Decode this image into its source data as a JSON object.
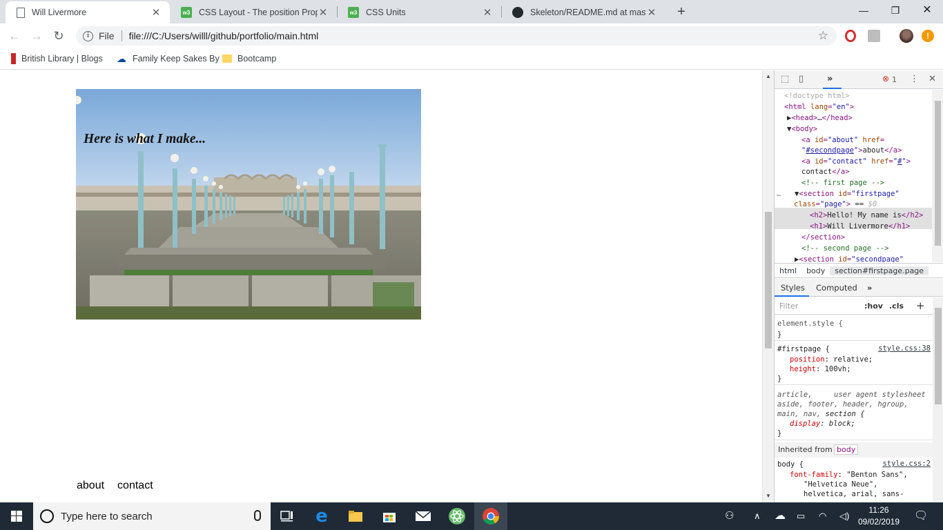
{
  "browser": {
    "tabs": [
      {
        "title": "Will Livermore",
        "icon": "document-icon",
        "active": true
      },
      {
        "title": "CSS Layout - The position Prope",
        "icon": "w3schools-icon",
        "active": false
      },
      {
        "title": "CSS Units",
        "icon": "w3schools-icon",
        "active": false
      },
      {
        "title": "Skeleton/README.md at master",
        "icon": "github-icon",
        "active": false
      }
    ],
    "new_tab": "+",
    "address": {
      "scheme": "File",
      "url": "file:///C:/Users/willl/github/portfolio/main.html"
    },
    "bookmarks": [
      {
        "label": "British Library | Blogs",
        "icon": "british-library-icon"
      },
      {
        "label": "Family Keep Sakes By",
        "icon": "onedrive-icon"
      },
      {
        "label": "Bootcamp",
        "icon": "folder-icon"
      }
    ]
  },
  "page": {
    "heading": "Here is what I make...",
    "nav": {
      "about": "about",
      "contact": "contact"
    }
  },
  "devtools": {
    "error_count": "1",
    "dom": [
      "<!doctype html>",
      "<html lang=\"en\">",
      "<head>…</head>",
      "<body>",
      "<a id=\"about\" href=",
      "\"#secondpage\">about</a>",
      "<a id=\"contact\" href=\"#\">",
      "contact</a>",
      "<!-- first page -->",
      "<section id=\"firstpage\"",
      "class=\"page\"> == $0",
      "<h2>Hello! My name is</h2>",
      "<h1>Will Livermore</h1>",
      "</section>",
      "<!-- second page -->",
      "<section id=\"secondpage\""
    ],
    "breadcrumbs": [
      "html",
      "body",
      "section#firstpage.page"
    ],
    "panel_tabs": {
      "styles": "Styles",
      "computed": "Computed"
    },
    "filter": {
      "placeholder": "Filter",
      "hov": ":hov",
      "cls": ".cls",
      "add": "+"
    },
    "rules": {
      "element_style": "element.style {",
      "firstpage_selector": "#firstpage {",
      "firstpage_source": "style.css:38",
      "firstpage_props": [
        {
          "name": "position",
          "value": "relative;"
        },
        {
          "name": "height",
          "value": "100vh;"
        }
      ],
      "ua_selector_1": "article,",
      "ua_source": "user agent stylesheet",
      "ua_selector_2": "aside, footer, header, hgroup,",
      "ua_selector_3_a": "main, nav, ",
      "ua_selector_3_b": "section",
      "ua_selector_3_c": " {",
      "ua_prop": {
        "name": "display",
        "value": "block;"
      },
      "inherited_label": "Inherited from",
      "inherited_from": "body",
      "body_selector": "body {",
      "body_source": "style.css:2",
      "body_prop_name": "font-family",
      "body_prop_values": [
        "\"Benton Sans\",",
        "\"Helvetica Neue\",",
        "helvetica, arial, sans-"
      ],
      "close_brace": "}"
    }
  },
  "taskbar": {
    "search_placeholder": "Type here to search",
    "time": "11:26",
    "date": "09/02/2019"
  },
  "colors": {
    "accent": "#1a73e8",
    "tag": "#881280",
    "attr": "#994500",
    "value": "#1a1aa6",
    "comment": "#236e25"
  }
}
